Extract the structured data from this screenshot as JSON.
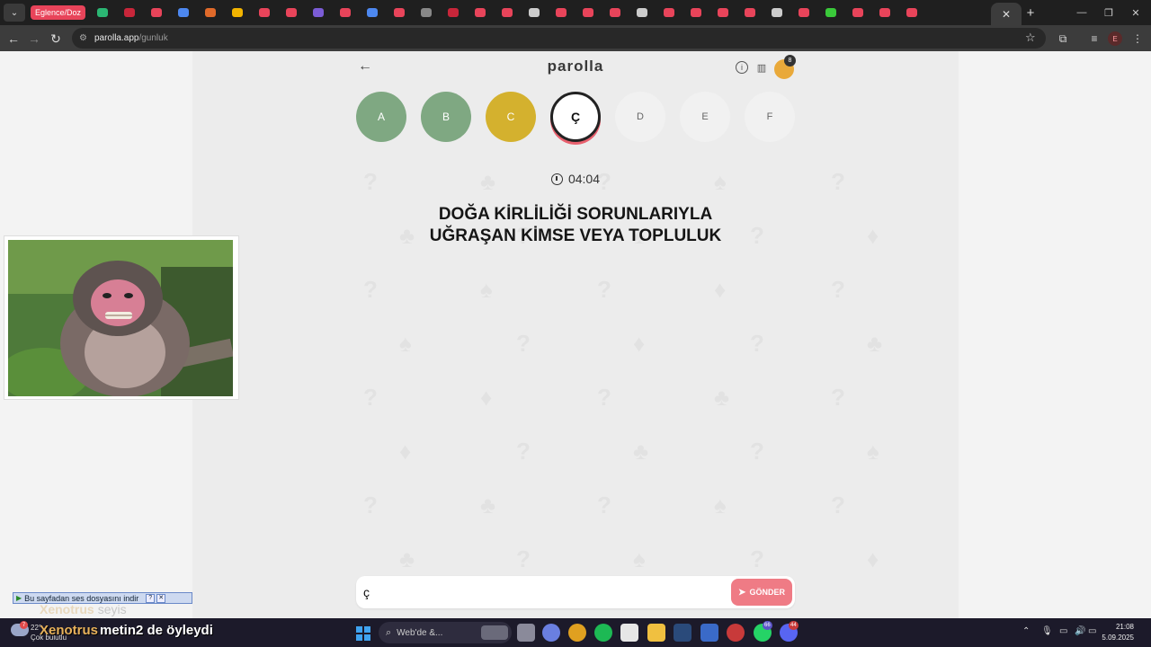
{
  "browser": {
    "first_tab_label": "Eglence/Doz",
    "url_host": "parolla.app",
    "url_path": "/gunluk",
    "profile_initial": "E",
    "tab_icon_colors": [
      "#2bb673",
      "#c8263a",
      "#e8445a",
      "#4d88f0",
      "#e06a2a",
      "#f2b400",
      "#e8445a",
      "#e8445a",
      "#7b5cd6",
      "#e8445a",
      "#4d88f0",
      "#e8445a",
      "#888888",
      "#c8263a",
      "#e8445a",
      "#e8445a",
      "#cccccc",
      "#e8445a",
      "#e8445a",
      "#e8445a",
      "#cccccc",
      "#e8445a",
      "#e8445a",
      "#e8445a",
      "#e8445a",
      "#cccccc",
      "#e8445a",
      "#3ac93a",
      "#e8445a",
      "#e8445a",
      "#e8445a"
    ]
  },
  "app": {
    "logo": "parolla",
    "profile_badge": "8"
  },
  "letters": [
    {
      "letter": "A",
      "state": "done"
    },
    {
      "letter": "B",
      "state": "done"
    },
    {
      "letter": "C",
      "state": "pass"
    },
    {
      "letter": "Ç",
      "state": "current"
    },
    {
      "letter": "D",
      "state": "todo"
    },
    {
      "letter": "E",
      "state": "todo"
    },
    {
      "letter": "F",
      "state": "todo"
    }
  ],
  "timer": "04:04",
  "question": {
    "line1": "DOĞA KİRLİLİĞİ SORUNLARIYLA",
    "line2": "UĞRAŞAN KİMSE VEYA TOPLULUK"
  },
  "answer": {
    "value": "ç",
    "send_label": "GÖNDER"
  },
  "overlay": {
    "audio_banner": "Bu sayfadan ses dosyasını indir",
    "faded_name": "Xenotrus",
    "faded_suffix": "seyis"
  },
  "taskbar": {
    "weather_temp": "22°",
    "weather_desc": "Çok bulutlu",
    "weather_badge": "7",
    "streamer": "Xenotrus",
    "message": "metin2 de öyleydi",
    "search_placeholder": "Web'de &...",
    "whatsapp_badge": "66",
    "discord_badge": "44",
    "time": "21:08",
    "date": "5.09.2025"
  },
  "colors": {
    "done": "#7fa882",
    "pass": "#d4b12e",
    "accent": "#ef7b85"
  }
}
